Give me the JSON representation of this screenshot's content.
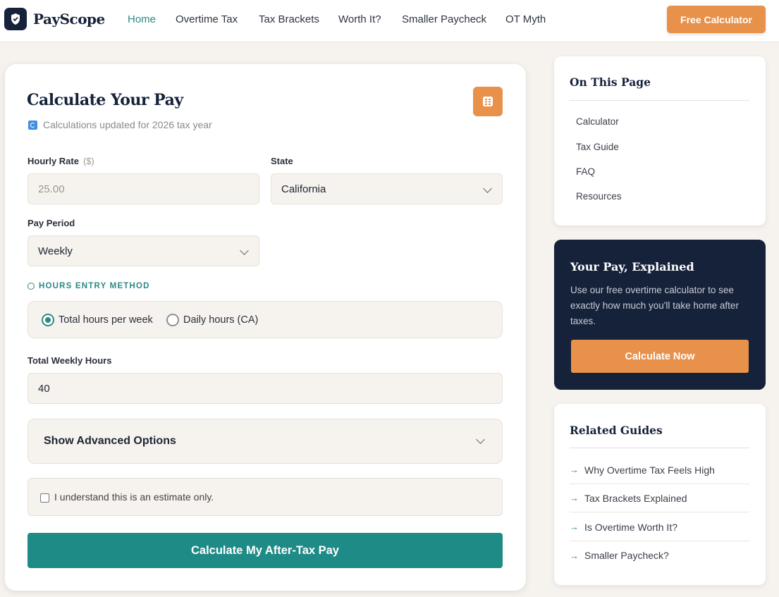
{
  "header": {
    "brand": "PayScope",
    "nav": [
      "Home",
      "Overtime Tax",
      "Tax Brackets",
      "Worth It?",
      "Smaller Paycheck",
      "OT Myth"
    ],
    "active_nav": "Home",
    "cta": "Free Calculator"
  },
  "calculator": {
    "title": "Calculate Your Pay",
    "subtitle": "Calculations updated for 2026 tax year",
    "hourly_rate_label": "Hourly Rate",
    "hourly_rate_unit": "($)",
    "hourly_rate_placeholder": "25.00",
    "state_label": "State",
    "state_value": "California",
    "pay_period_label": "Pay Period",
    "pay_period_value": "Weekly",
    "hours_method_title": "HOURS ENTRY METHOD",
    "hours_options": [
      "Total hours per week",
      "Daily hours (CA)"
    ],
    "hours_option_selected": "Total hours per week",
    "weekly_hours_label": "Total Weekly Hours",
    "weekly_hours_value": "40",
    "advanced_label": "Show Advanced Options",
    "ack_text": "I understand this is an estimate only.",
    "ack_checked": false,
    "submit_label": "Calculate My After-Tax Pay"
  },
  "sidebar": {
    "toc_title": "On This Page",
    "toc_items": [
      "Calculator",
      "Tax Guide",
      "FAQ",
      "Resources"
    ],
    "explain_title": "Your Pay, Explained",
    "explain_text": "Use our free overtime calculator to see exactly how much you'll take home after taxes.",
    "explain_button": "Calculate Now",
    "guides_title": "Related Guides",
    "guides": [
      "Why Overtime Tax Feels High",
      "Tax Brackets Explained",
      "Is Overtime Worth It?",
      "Smaller Paycheck?"
    ],
    "arrow_glyph": "→"
  },
  "colors": {
    "accent_teal": "#1f8b86",
    "accent_orange": "#e8914a",
    "navy": "#16223a",
    "background": "#f6f3ee"
  }
}
